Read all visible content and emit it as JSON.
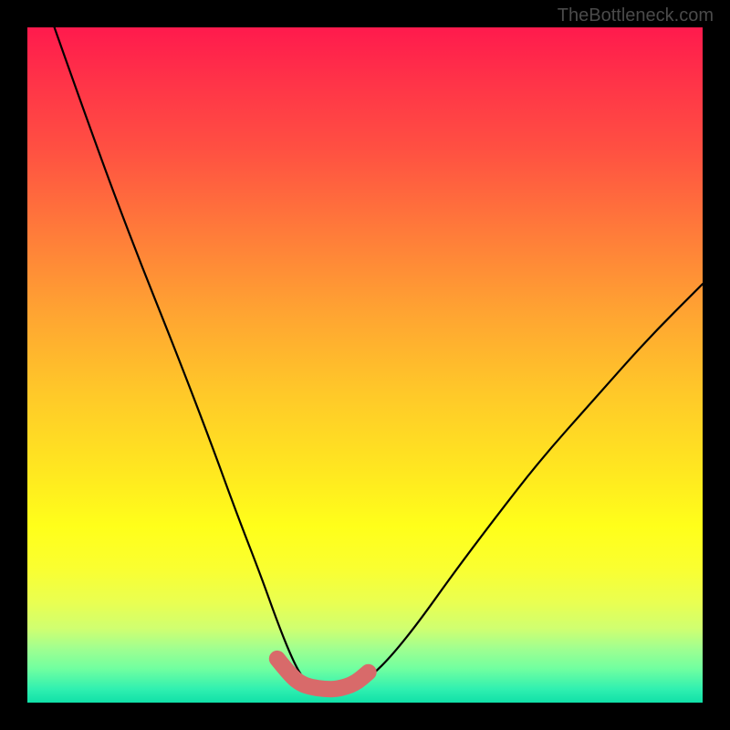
{
  "watermark": "TheBottleneck.com",
  "chart_data": {
    "type": "line",
    "title": "",
    "xlabel": "",
    "ylabel": "",
    "xlim": [
      0,
      100
    ],
    "ylim": [
      0,
      100
    ],
    "series": [
      {
        "name": "bottleneck-curve",
        "x": [
          4,
          10,
          16,
          22,
          27,
          31,
          34.5,
          37,
          39,
          40.5,
          42,
          44,
          46,
          48.5,
          51,
          54,
          58,
          63,
          69,
          76,
          84,
          92,
          100
        ],
        "values": [
          100,
          83,
          67,
          52,
          39,
          28,
          19,
          12,
          7,
          4,
          2.5,
          2,
          2,
          2.5,
          4,
          7,
          12,
          19,
          27,
          36,
          45,
          54,
          62
        ]
      },
      {
        "name": "highlight-segment",
        "x": [
          37,
          39,
          40.5,
          42,
          44,
          46,
          48.5,
          50.5
        ],
        "values": [
          6.5,
          4,
          2.8,
          2.3,
          2,
          2,
          2.8,
          4.5
        ]
      }
    ],
    "background_gradient": {
      "top_color": "#ff1a4d",
      "mid_color": "#ffff1a",
      "bottom_color": "#10e0a8"
    }
  }
}
